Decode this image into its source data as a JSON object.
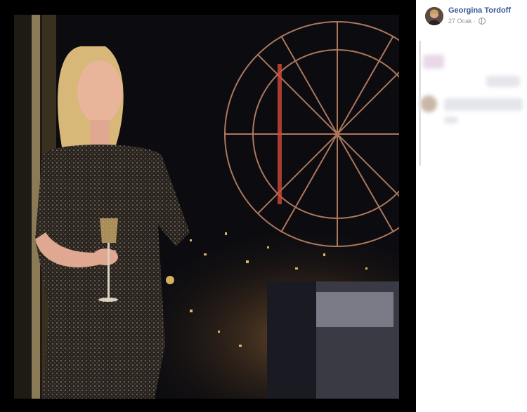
{
  "post": {
    "author_name": "Georgina Tordoff",
    "date": "27 Ocak",
    "separator": "·",
    "privacy_icon": "globe-icon"
  },
  "photo": {
    "subject": "woman-in-sparkly-dress-holding-wine-glass",
    "background": "night-city-view-with-ferris-wheel"
  },
  "colors": {
    "link": "#365899",
    "meta": "#90949c",
    "viewer_bg": "#000000"
  }
}
